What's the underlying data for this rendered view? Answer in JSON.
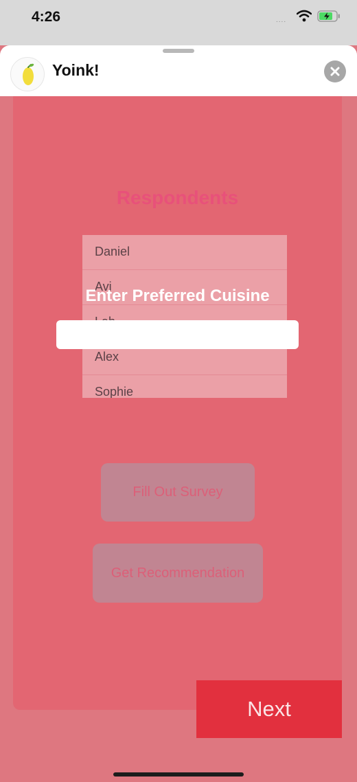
{
  "status_bar": {
    "time": "4:26",
    "signal": "....",
    "icons": [
      "wifi-icon",
      "battery-charging-icon"
    ]
  },
  "sheet": {
    "app_name": "Yoink!",
    "app_icon": "lemon-icon",
    "close_icon": "close-icon"
  },
  "main": {
    "title": "Respondents",
    "respondents": [
      "Daniel",
      "Avi",
      "Lab",
      "Alex",
      "Sophie"
    ],
    "cuisine_prompt": "Enter Preferred Cuisine",
    "cuisine_value": "",
    "survey_button": "Fill Out Survey",
    "recommend_button": "Get Recommendation"
  },
  "footer": {
    "next_button": "Next"
  },
  "colors": {
    "overlay": "#de7780",
    "card": "#e36672",
    "title": "#e8517a",
    "next": "#e2303e"
  }
}
